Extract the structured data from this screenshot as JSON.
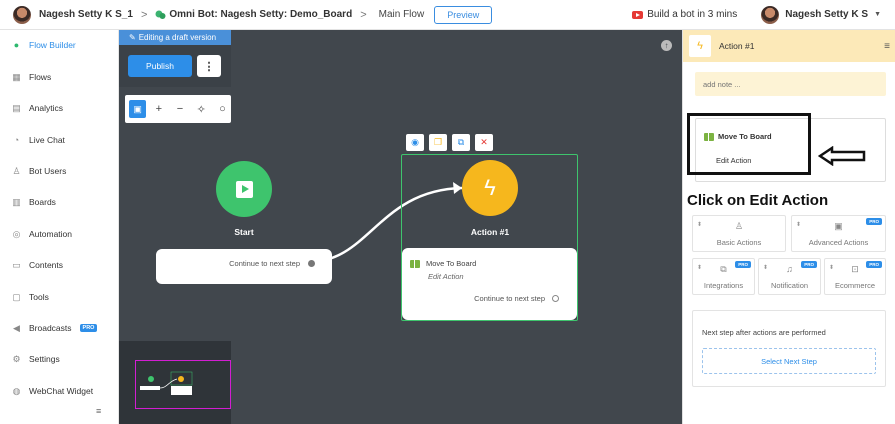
{
  "header": {
    "workspace_name": "Nagesh Setty K S_1",
    "separator": ">",
    "bot_name": "Omni Bot: Nagesh Setty: Demo_Board",
    "flow_name": "Main Flow",
    "preview_label": "Preview",
    "tutorial_label": "Build a bot in 3 mins",
    "user_name": "Nagesh Setty K S"
  },
  "sidebar": {
    "items": [
      {
        "label": "Flow Builder",
        "icon": "chat-bubbles-icon"
      },
      {
        "label": "Flows",
        "icon": "grid-icon"
      },
      {
        "label": "Analytics",
        "icon": "chart-icon"
      },
      {
        "label": "Live Chat",
        "icon": "headset-icon"
      },
      {
        "label": "Bot Users",
        "icon": "user-icon"
      },
      {
        "label": "Boards",
        "icon": "board-icon"
      },
      {
        "label": "Automation",
        "icon": "automation-icon"
      },
      {
        "label": "Contents",
        "icon": "contents-icon"
      },
      {
        "label": "Tools",
        "icon": "tools-icon"
      },
      {
        "label": "Broadcasts",
        "icon": "megaphone-icon",
        "badge": "PRO"
      },
      {
        "label": "Settings",
        "icon": "gear-icon"
      },
      {
        "label": "WebChat Widget",
        "icon": "globe-icon"
      }
    ]
  },
  "canvas": {
    "draft_banner": "Editing a draft version",
    "publish_label": "Publish",
    "start_node": {
      "label": "Start",
      "next_step": "Continue to next step"
    },
    "action_node": {
      "label": "Action #1",
      "action_title": "Move To Board",
      "action_sub": "Edit Action",
      "next_step": "Continue to next step"
    }
  },
  "panel": {
    "title": "Action #1",
    "note_placeholder": "add note ...",
    "action_title": "Move To Board",
    "edit_action": "Edit Action",
    "instruction": "Click on Edit Action",
    "categories": [
      {
        "label": "Basic Actions",
        "pro": ""
      },
      {
        "label": "Advanced Actions",
        "pro": "PRO"
      },
      {
        "label": "Integrations",
        "pro": "PRO"
      },
      {
        "label": "Notification",
        "pro": "PRO"
      },
      {
        "label": "Ecommerce",
        "pro": "PRO"
      }
    ],
    "next_step_label": "Next step after actions are performed",
    "select_next_step": "Select Next Step"
  },
  "colors": {
    "accent": "#2d8ee8",
    "start_node": "#3ec46d",
    "action_node": "#f6b71d",
    "canvas_bg": "#41474d",
    "panel_header": "#fce9b8"
  }
}
